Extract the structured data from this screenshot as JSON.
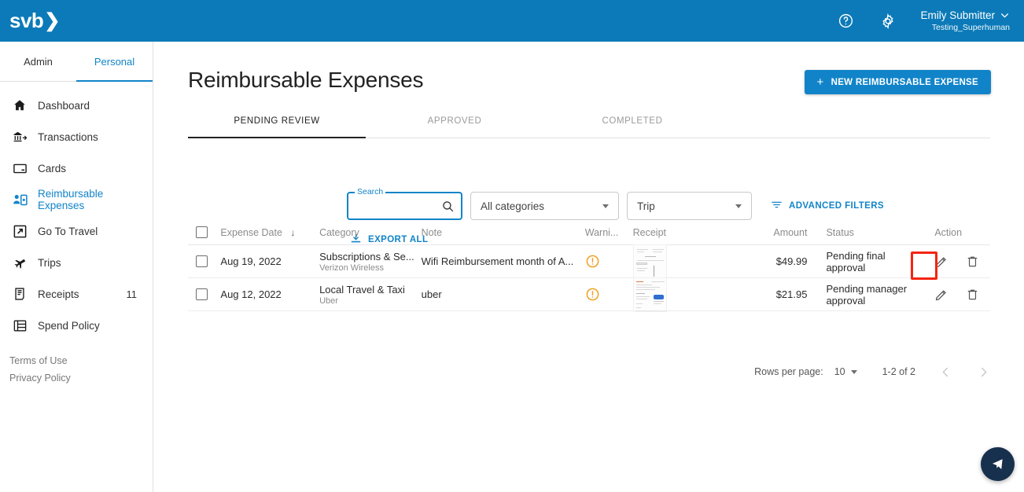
{
  "header": {
    "logo_text": "svb",
    "logo_chevron": "❯",
    "help_icon": "help-circle-icon",
    "settings_icon": "gear-icon",
    "user_name": "Emily Submitter",
    "user_org": "Testing_Superhuman",
    "brand_color": "#0c7ab8"
  },
  "sidebar": {
    "tabs": [
      {
        "label": "Admin",
        "active": false
      },
      {
        "label": "Personal",
        "active": true
      }
    ],
    "items": [
      {
        "label": "Dashboard",
        "icon": "home-icon",
        "badge": "",
        "active": false
      },
      {
        "label": "Transactions",
        "icon": "bank-transfer-icon",
        "badge": "",
        "active": false
      },
      {
        "label": "Cards",
        "icon": "credit-card-icon",
        "badge": "",
        "active": false
      },
      {
        "label": "Reimbursable Expenses",
        "icon": "person-badge-icon",
        "badge": "",
        "active": true
      },
      {
        "label": "Go To Travel",
        "icon": "external-link-icon",
        "badge": "",
        "active": false
      },
      {
        "label": "Trips",
        "icon": "airplane-icon",
        "badge": "",
        "active": false
      },
      {
        "label": "Receipts",
        "icon": "receipt-icon",
        "badge": "11",
        "active": false
      },
      {
        "label": "Spend Policy",
        "icon": "policy-list-icon",
        "badge": "",
        "active": false
      }
    ],
    "links": [
      {
        "label": "Terms of Use"
      },
      {
        "label": "Privacy Policy"
      }
    ]
  },
  "main": {
    "page_title": "Reimbursable Expenses",
    "new_button": {
      "label": "NEW REIMBURSABLE EXPENSE",
      "icon": "plus-icon"
    },
    "tabs": [
      {
        "label": "PENDING REVIEW",
        "active": true
      },
      {
        "label": "APPROVED",
        "active": false
      },
      {
        "label": "COMPLETED",
        "active": false
      }
    ],
    "filters": {
      "search": {
        "label": "Search",
        "value": "",
        "placeholder": "",
        "icon": "search-icon"
      },
      "categories_select": {
        "value": "All categories"
      },
      "trip_select": {
        "value": "Trip"
      },
      "advanced_filters": {
        "label": "ADVANCED FILTERS",
        "icon": "filter-icon"
      },
      "export_all": {
        "label": "EXPORT ALL",
        "icon": "download-icon"
      }
    },
    "table": {
      "columns": [
        "Expense Date",
        "Category",
        "Note",
        "Warni...",
        "Receipt",
        "Amount",
        "Status",
        "Action"
      ],
      "sort": {
        "column": "Expense Date",
        "direction": "desc",
        "arrow": "↓"
      },
      "rows": [
        {
          "date": "Aug 19, 2022",
          "category": "Subscriptions & Se...",
          "merchant": "Verizon Wireless",
          "note": "Wifi Reimbursement month of A...",
          "warning": "warning-icon",
          "receipt": "receipt-thumbnail",
          "amount": "$49.99",
          "status": "Pending final approval",
          "actions": [
            "edit-icon",
            "delete-icon"
          ],
          "highlighted_action": "delete-icon"
        },
        {
          "date": "Aug 12, 2022",
          "category": "Local Travel & Taxi",
          "merchant": "Uber",
          "note": "uber",
          "warning": "warning-icon",
          "receipt": "receipt-thumbnail",
          "amount": "$21.95",
          "status": "Pending manager approval",
          "actions": [
            "edit-icon",
            "delete-icon"
          ],
          "highlighted_action": ""
        }
      ]
    },
    "pagination": {
      "rows_per_page_label": "Rows per page:",
      "rows_per_page_value": "10",
      "range": "1-2 of 2",
      "prev_icon": "chevron-left-icon",
      "next_icon": "chevron-right-icon"
    }
  },
  "fab": {
    "icon": "send-arrow-icon",
    "color": "#17304d"
  },
  "annotation": {
    "highlight_color": "#f52410"
  }
}
